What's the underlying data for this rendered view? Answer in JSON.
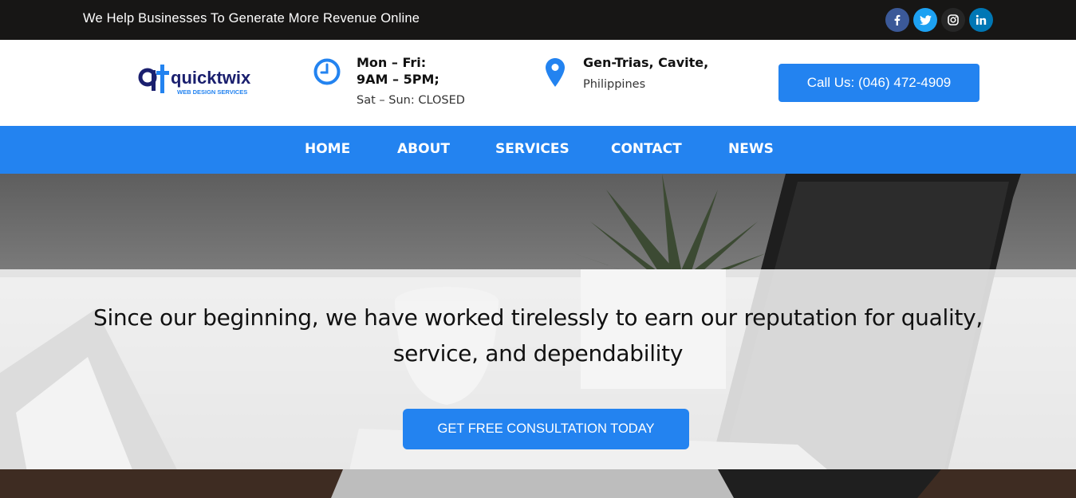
{
  "topbar": {
    "tagline": "We Help Businesses To Generate More Revenue Online",
    "social": [
      {
        "icon": "facebook-icon",
        "color": "#3b5998"
      },
      {
        "icon": "twitter-icon",
        "color": "#1da1f2"
      },
      {
        "icon": "instagram-icon",
        "color": "#262626"
      },
      {
        "icon": "linkedin-icon",
        "color": "#0077b5"
      }
    ]
  },
  "header": {
    "logo": {
      "mark": "qt",
      "name": "quicktwix",
      "sub": "WEB DESIGN SERVICES"
    },
    "hours": {
      "line1": "Mon – Fri:",
      "line2": "9AM – 5PM;",
      "line3": "Sat – Sun: CLOSED",
      "icon": "clock-icon"
    },
    "location": {
      "line1": "Gen-Trias, Cavite,",
      "line2": "Philippines",
      "icon": "map-pin-icon"
    },
    "call_button": "Call Us: (046) 472-4909"
  },
  "nav": {
    "items": [
      "HOME",
      "ABOUT",
      "SERVICES",
      "CONTACT",
      "NEWS"
    ]
  },
  "hero": {
    "line1": "Since our beginning, we have worked tirelessly to earn our reputation for quality,",
    "line2": "service, and dependability",
    "cta": "GET FREE CONSULTATION TODAY"
  },
  "colors": {
    "accent": "#2383f0",
    "topbar": "#171615"
  }
}
